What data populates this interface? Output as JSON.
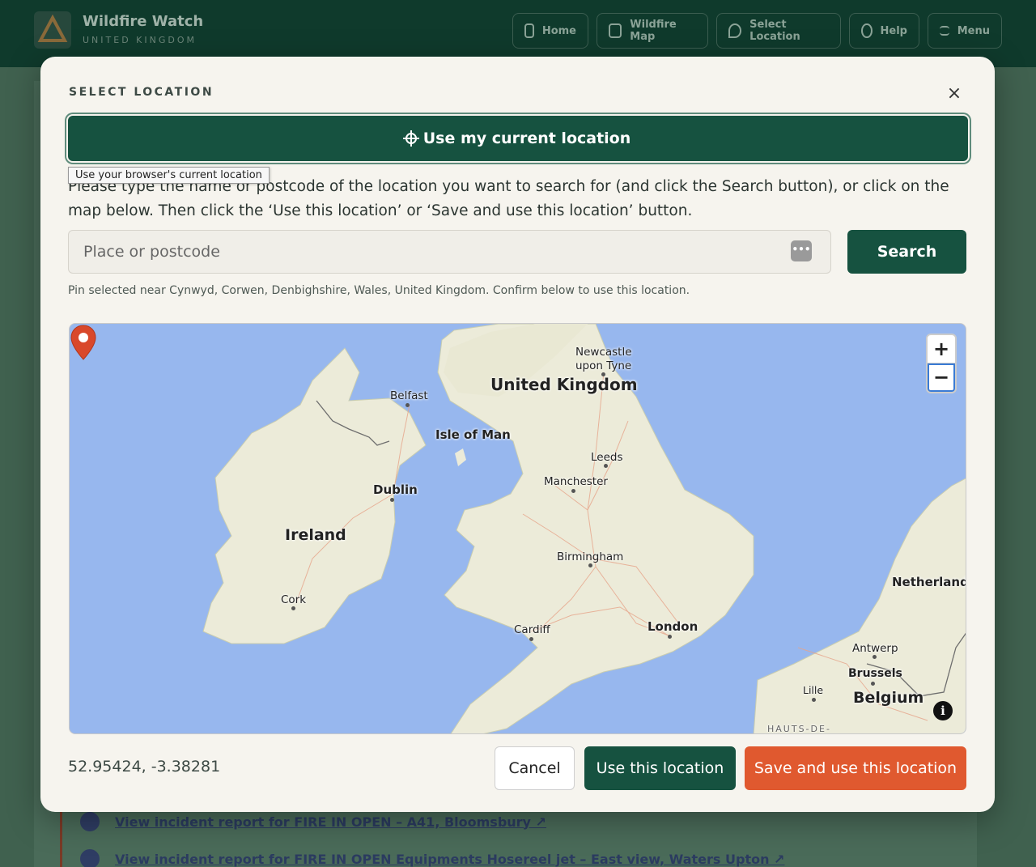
{
  "header": {
    "brand_title": "Wildfire Watch",
    "brand_subtitle": "UNITED KINGDOM",
    "nav": [
      {
        "label": "Home",
        "icon": "home-icon"
      },
      {
        "label": "Wildfire Map",
        "icon": "map-icon"
      },
      {
        "label": "Select Location",
        "icon": "location-pin-icon"
      },
      {
        "label": "Help",
        "icon": "help-icon"
      },
      {
        "label": "Menu",
        "icon": "hamburger-icon"
      }
    ]
  },
  "background": {
    "incidents": [
      {
        "label": "View incident report for FIRE IN OPEN – A41, Bloomsbury ↗"
      },
      {
        "label": "View incident report for FIRE IN OPEN Equipments Hosereel jet – East view, Waters Upton ↗"
      }
    ]
  },
  "modal": {
    "title": "SELECT LOCATION",
    "close_symbol": "×",
    "use_current_label": "Use my current location",
    "tooltip": "Use your browser's current location",
    "instructions": "Please type the name or postcode of the location you want to search for (and click the Search button), or click on the map below. Then click the ‘Use this location’ or ‘Save and use this location’ button.",
    "search": {
      "placeholder": "Place or postcode",
      "value": "",
      "button_label": "Search"
    },
    "status_message": "Pin selected near Cynwyd, Corwen, Denbighshire, Wales, United Kingdom. Confirm below to use this location.",
    "map": {
      "zoom_in": "+",
      "zoom_out": "−",
      "info": "i",
      "labels": {
        "united_kingdom": "United Kingdom",
        "ireland": "Ireland",
        "isle_of_man": "Isle of Man",
        "belgium": "Belgium",
        "netherlands": "Netherlands",
        "newcastle": "Newcastle upon Tyne",
        "belfast": "Belfast",
        "dublin": "Dublin",
        "leeds": "Leeds",
        "manchester": "Manchester",
        "birmingham": "Birmingham",
        "cork": "Cork",
        "cardiff": "Cardiff",
        "london": "London",
        "antwerp": "Antwerp",
        "brussels": "Brussels",
        "lille": "Lille",
        "hauts_de_france": "HAUTS-DE-"
      },
      "colors": {
        "sea": "#97b7ee",
        "land": "#ecebd9",
        "pin": "#d9482b"
      }
    },
    "coordinates": "52.95424, -3.38281",
    "buttons": {
      "cancel": "Cancel",
      "use": "Use this location",
      "save": "Save and use this location"
    }
  }
}
